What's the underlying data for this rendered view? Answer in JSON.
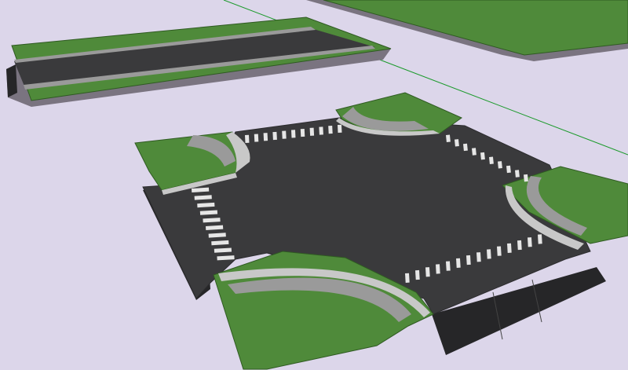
{
  "viewport": {
    "background": "#dcd6ea"
  },
  "colors": {
    "grass": "#4f8a3a",
    "grass_dark": "#3f7a2e",
    "grass_edge": "#2f5a22",
    "asphalt": "#3a3a3c",
    "asphalt_dark": "#2c2c2e",
    "asphalt_side": "#262628",
    "sidewalk": "#9a9a9a",
    "curb": "#c8c8c8",
    "crosswalk": "#e6e6e6",
    "axis_green": "#1a9a2a",
    "shadow": "#7a7480"
  },
  "scene": {
    "objects": [
      "green-axis-line",
      "grass-plane",
      "road-segment",
      "intersection"
    ]
  }
}
